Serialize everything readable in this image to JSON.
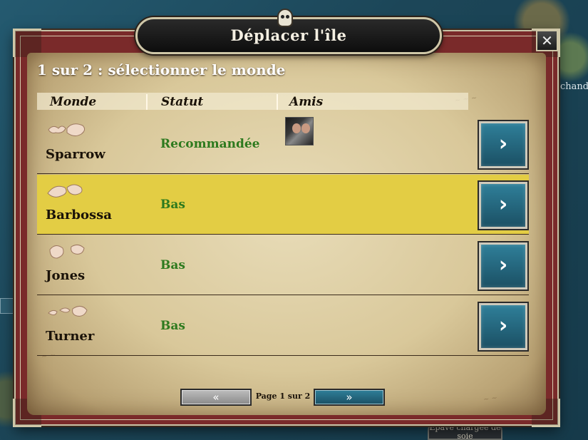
{
  "window": {
    "title": "Déplacer l'île",
    "close_label": "✕"
  },
  "step_title": "1 sur 2 : sélectionner le monde",
  "table": {
    "headers": {
      "world": "Monde",
      "status": "Statut",
      "friends": "Amis"
    },
    "rows": [
      {
        "name": "Sparrow",
        "status": "Recommandée",
        "has_friend": true,
        "highlighted": false,
        "action": "›"
      },
      {
        "name": "Barbossa",
        "status": "Bas",
        "has_friend": false,
        "highlighted": true,
        "action": "›"
      },
      {
        "name": "Jones",
        "status": "Bas",
        "has_friend": false,
        "highlighted": false,
        "action": "›"
      },
      {
        "name": "Turner",
        "status": "Bas",
        "has_friend": false,
        "highlighted": false,
        "action": "›"
      }
    ]
  },
  "pagination": {
    "prev_label": "«",
    "next_label": "»",
    "page_info": "Page 1 sur 2"
  },
  "background": {
    "right_partial_text": "chand",
    "bottom_label": "Épave chargée de soie"
  },
  "colors": {
    "status_green": "#2e7a1e",
    "highlight_row": "#e3cd44",
    "action_button": "#1b5064",
    "frame_red": "#7a2a2a"
  },
  "icons": {
    "skull": "skull-icon",
    "close": "close-icon",
    "world": "island-map-icon",
    "arrow": "chevron-right-icon"
  }
}
